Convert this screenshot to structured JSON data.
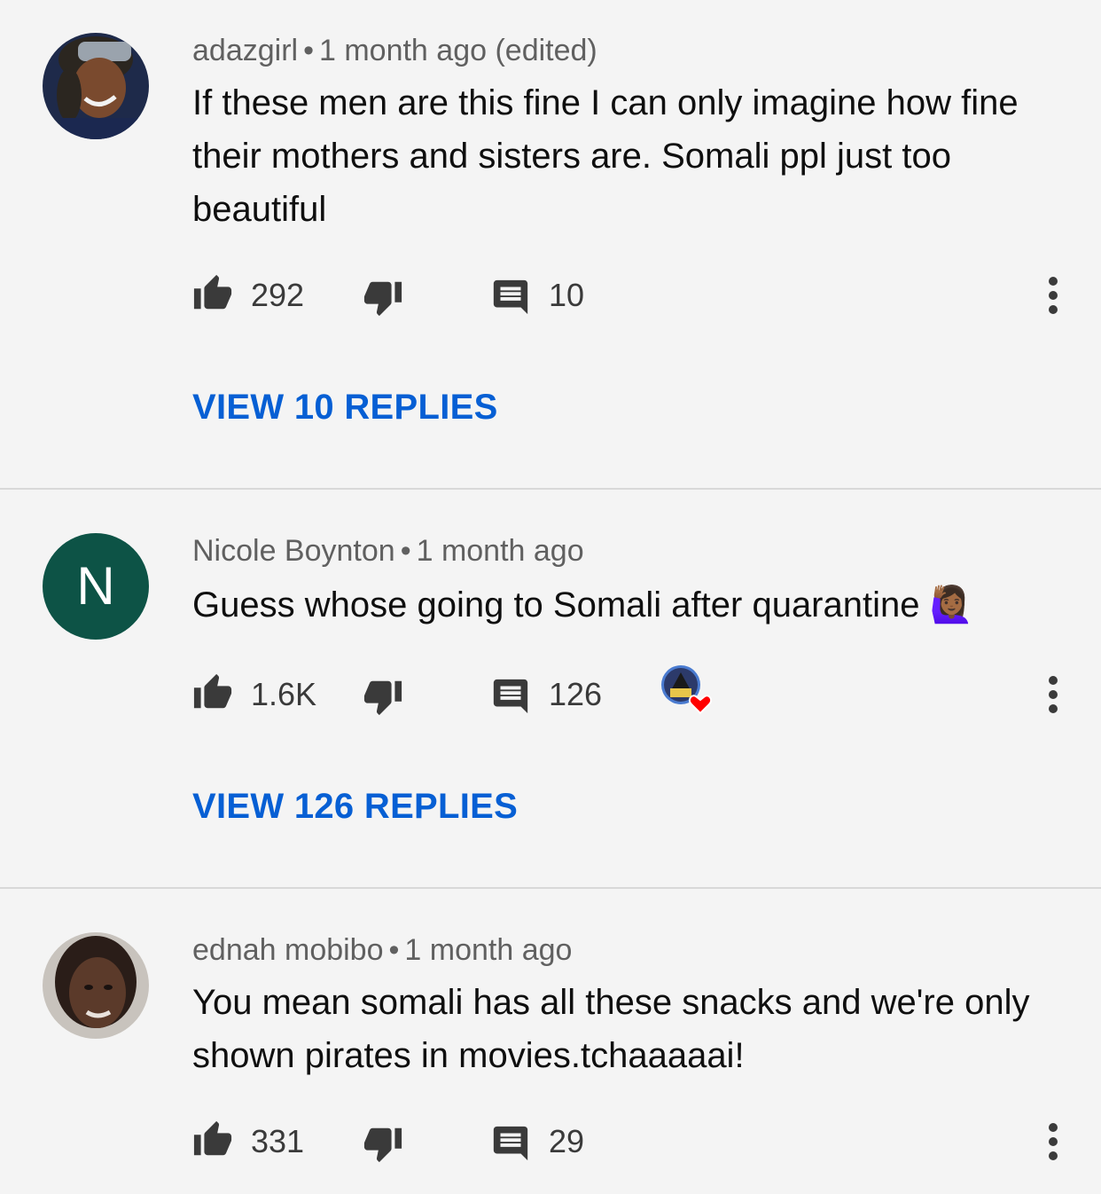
{
  "comments": [
    {
      "author": "adazgirl",
      "separator": "•",
      "time": "1 month ago (edited)",
      "text": "If these men are this fine I can only imagine how fine their mothers and sisters are. Somali ppl just too beautiful",
      "likes": "292",
      "replies_count": "10",
      "view_replies": "VIEW 10 REPLIES",
      "avatar": "photo"
    },
    {
      "author": "Nicole Boynton",
      "separator": "•",
      "time": "1 month ago",
      "text": "Guess whose going to Somali after quarantine 🙋🏾‍♀️",
      "likes": "1.6K",
      "replies_count": "126",
      "view_replies": "VIEW 126 REPLIES",
      "avatar": "letter",
      "avatar_letter": "N",
      "avatar_color": "#0d5346",
      "creator_heart": true
    },
    {
      "author": "ednah mobibo",
      "separator": "•",
      "time": "1 month ago",
      "text": "You mean somali has all these snacks and we're only shown pirates in movies.tchaaaaai!",
      "likes": "331",
      "replies_count": "29",
      "avatar": "photo"
    }
  ],
  "colors": {
    "background": "#f4f4f4",
    "link_blue": "#065fd4",
    "meta_gray": "#606060",
    "icon_gray": "#3a3a3a",
    "heart_red": "#ff0000"
  },
  "icons": [
    "like-icon",
    "dislike-icon",
    "reply-icon",
    "more-options-icon",
    "creator-heart-icon"
  ]
}
